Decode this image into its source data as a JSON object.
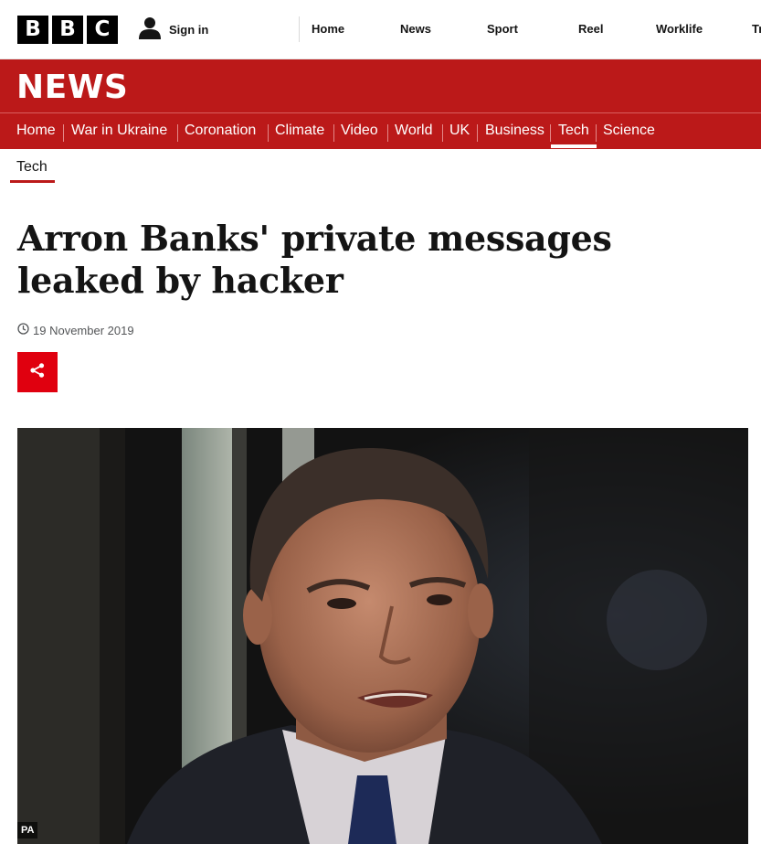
{
  "topbar": {
    "logo": [
      "B",
      "B",
      "C"
    ],
    "signin_label": "Sign in",
    "nav": [
      "Home",
      "News",
      "Sport",
      "Reel",
      "Worklife",
      "Tr"
    ]
  },
  "newsband": {
    "title": "NEWS",
    "sections": [
      "Home",
      "War in Ukraine",
      "Coronation",
      "Climate",
      "Video",
      "World",
      "UK",
      "Business",
      "Tech",
      "Science"
    ],
    "active_section": "Tech"
  },
  "subnav": {
    "label": "Tech"
  },
  "article": {
    "headline": "Arron Banks' private messages leaked by hacker",
    "date": "19 November 2019",
    "image_credit": "PA"
  },
  "colors": {
    "brand_red": "#bb1919",
    "share_red": "#e0000f"
  },
  "icons": {
    "signin": "user-icon",
    "date": "clock-icon",
    "share": "share-icon"
  }
}
